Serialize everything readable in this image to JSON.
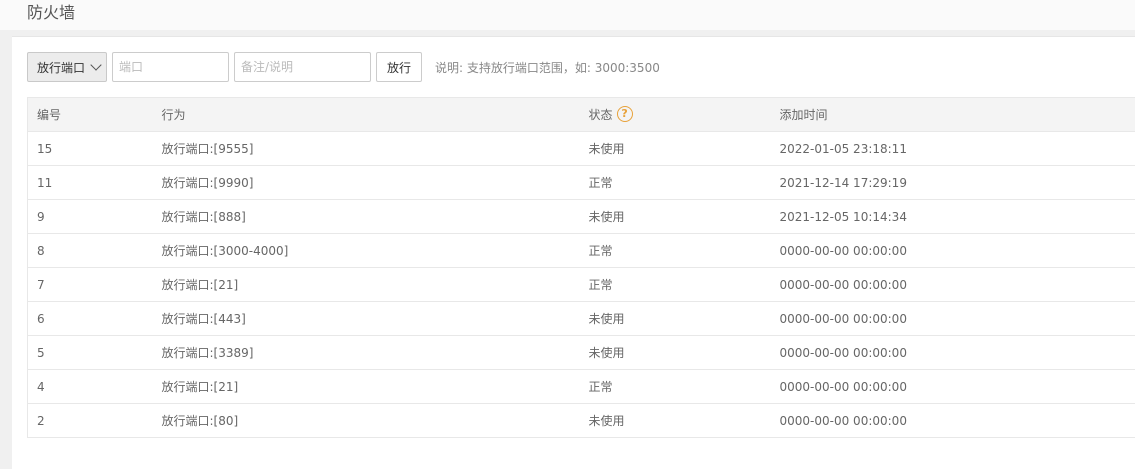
{
  "page": {
    "title": "防火墙"
  },
  "toolbar": {
    "select_value": "放行端口",
    "port_placeholder": "端口",
    "note_placeholder": "备注/说明",
    "submit_label": "放行",
    "hint": "说明: 支持放行端口范围，如: 3000:3500"
  },
  "table": {
    "headers": [
      "编号",
      "行为",
      "状态",
      "添加时间"
    ],
    "status_help_icon": "question-circle-icon",
    "rows": [
      {
        "id": "15",
        "action": "放行端口:[9555]",
        "status": "未使用",
        "time": "2022-01-05 23:18:11"
      },
      {
        "id": "11",
        "action": "放行端口:[9990]",
        "status": "正常",
        "time": "2021-12-14 17:29:19"
      },
      {
        "id": "9",
        "action": "放行端口:[888]",
        "status": "未使用",
        "time": "2021-12-05 10:14:34"
      },
      {
        "id": "8",
        "action": "放行端口:[3000-4000]",
        "status": "正常",
        "time": "0000-00-00 00:00:00"
      },
      {
        "id": "7",
        "action": "放行端口:[21]",
        "status": "正常",
        "time": "0000-00-00 00:00:00"
      },
      {
        "id": "6",
        "action": "放行端口:[443]",
        "status": "未使用",
        "time": "0000-00-00 00:00:00"
      },
      {
        "id": "5",
        "action": "放行端口:[3389]",
        "status": "未使用",
        "time": "0000-00-00 00:00:00"
      },
      {
        "id": "4",
        "action": "放行端口:[21]",
        "status": "正常",
        "time": "0000-00-00 00:00:00"
      },
      {
        "id": "2",
        "action": "放行端口:[80]",
        "status": "未使用",
        "time": "0000-00-00 00:00:00"
      }
    ]
  },
  "colors": {
    "help_icon": "#e8a23a",
    "header_bg": "#f4f4f4",
    "page_bg": "#f0f0f0"
  }
}
